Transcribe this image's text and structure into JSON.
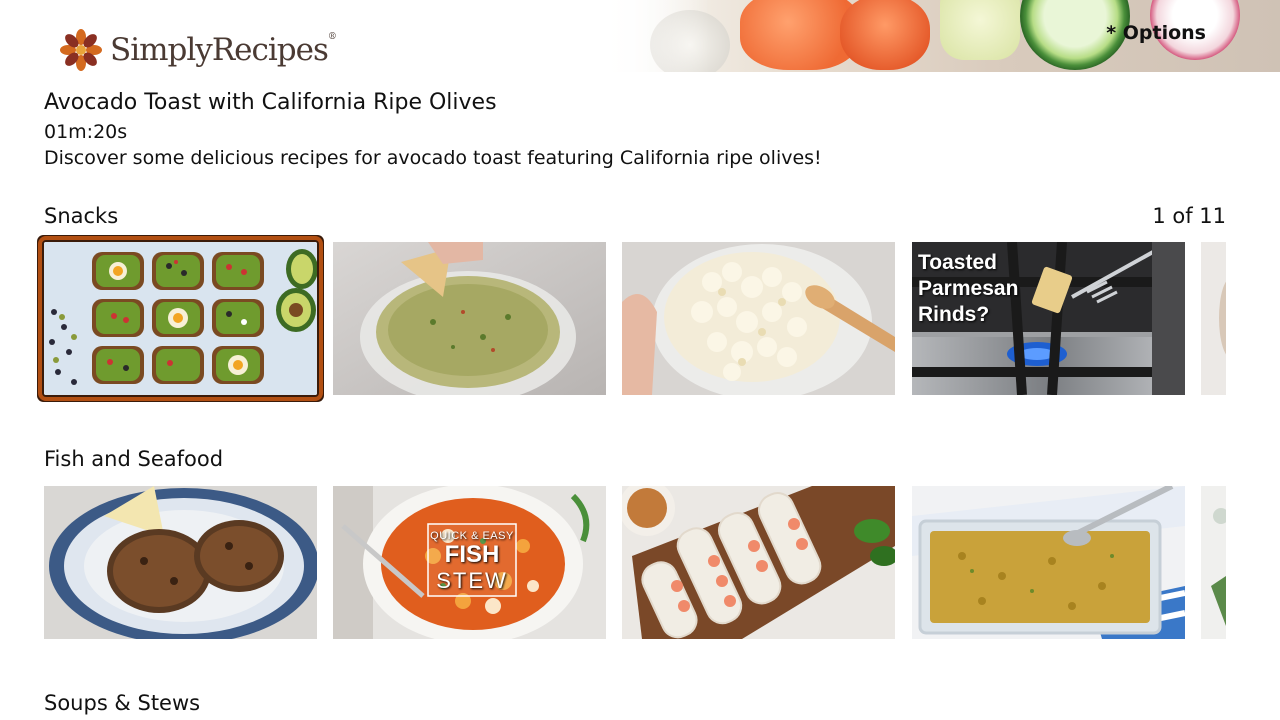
{
  "header": {
    "logo_text": "SimplyRecipes",
    "logo_reg": "®",
    "options_label": "* Options"
  },
  "featured": {
    "title": "Avocado Toast with California Ripe Olives",
    "duration": "01m:20s",
    "description": "Discover some delicious recipes for avocado toast featuring California ripe olives!"
  },
  "rows": [
    {
      "title": "Snacks",
      "position": "1 of 11",
      "tiles": [
        {
          "name": "avocado-toast",
          "selected": true
        },
        {
          "name": "guacamole"
        },
        {
          "name": "popcorn"
        },
        {
          "name": "toasted-parmesan-rinds",
          "overlay_text": [
            "Toasted",
            "Parmesan",
            "Rinds?"
          ]
        },
        {
          "name": "partial"
        }
      ]
    },
    {
      "title": "Fish and Seafood",
      "tiles": [
        {
          "name": "salmon-patties"
        },
        {
          "name": "fish-stew",
          "overlay_text": [
            "QUICK & EASY",
            "FISH",
            "STEW"
          ]
        },
        {
          "name": "shrimp-spring-rolls"
        },
        {
          "name": "baked-fish-casserole"
        },
        {
          "name": "partial"
        }
      ]
    },
    {
      "title": "Soups & Stews"
    }
  ],
  "colors": {
    "selection_outline": "#b24f12",
    "text": "#111111",
    "logo_brown": "#4a3a33"
  }
}
